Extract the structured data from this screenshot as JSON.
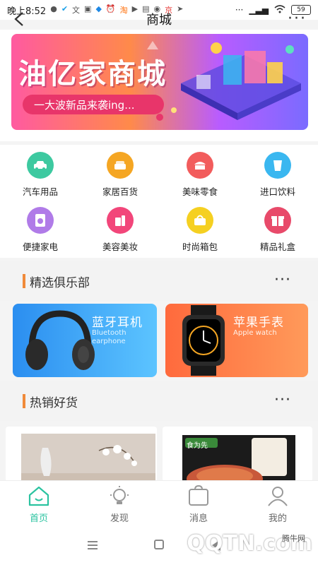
{
  "status_bar": {
    "time": "晚上8:52",
    "icons": [
      "cloud-icon",
      "alipay-icon",
      "text-icon",
      "calendar-icon",
      "shield-icon",
      "alarm-icon",
      "taobao-icon",
      "play-icon",
      "bag-icon",
      "eye-icon",
      "jd-icon",
      "arrow-icon"
    ],
    "more": "···",
    "battery": "59"
  },
  "header": {
    "title": "商城"
  },
  "banner": {
    "title": "油亿家商城",
    "tagline": "一大波新品来袭ing..."
  },
  "categories": [
    {
      "label": "汽车用品",
      "color": "#3dc9a0",
      "icon": "car-icon"
    },
    {
      "label": "家居百货",
      "color": "#f5a623",
      "icon": "home-icon"
    },
    {
      "label": "美味零食",
      "color": "#f25c5c",
      "icon": "snack-icon"
    },
    {
      "label": "进口饮料",
      "color": "#3ab7f0",
      "icon": "drink-icon"
    },
    {
      "label": "便捷家电",
      "color": "#b07be8",
      "icon": "appliance-icon"
    },
    {
      "label": "美容美妆",
      "color": "#f2467a",
      "icon": "cosmetic-icon"
    },
    {
      "label": "时尚箱包",
      "color": "#f5d021",
      "icon": "handbag-icon"
    },
    {
      "label": "精品礼盒",
      "color": "#e84a6a",
      "icon": "gift-icon"
    }
  ],
  "section_club": {
    "title": "精选俱乐部",
    "more": "···",
    "cards": [
      {
        "title": "蓝牙耳机",
        "subtitle": "Bluetooth earphone"
      },
      {
        "title": "苹果手表",
        "subtitle": "Apple watch"
      }
    ]
  },
  "section_hot": {
    "title": "热销好货",
    "more": "···",
    "product_right_brand": "食为先"
  },
  "tabbar": {
    "tabs": [
      {
        "label": "首页",
        "icon": "home-icon",
        "active": true
      },
      {
        "label": "发现",
        "icon": "bulb-icon",
        "active": false
      },
      {
        "label": "消息",
        "icon": "message-icon",
        "active": false
      },
      {
        "label": "我的",
        "icon": "user-icon",
        "active": false
      }
    ]
  },
  "watermark": {
    "text": "QQTN.com",
    "small": "腾牛网"
  },
  "colors": {
    "accent": "#2bc3a0",
    "section_bar": "#f08a3a"
  }
}
